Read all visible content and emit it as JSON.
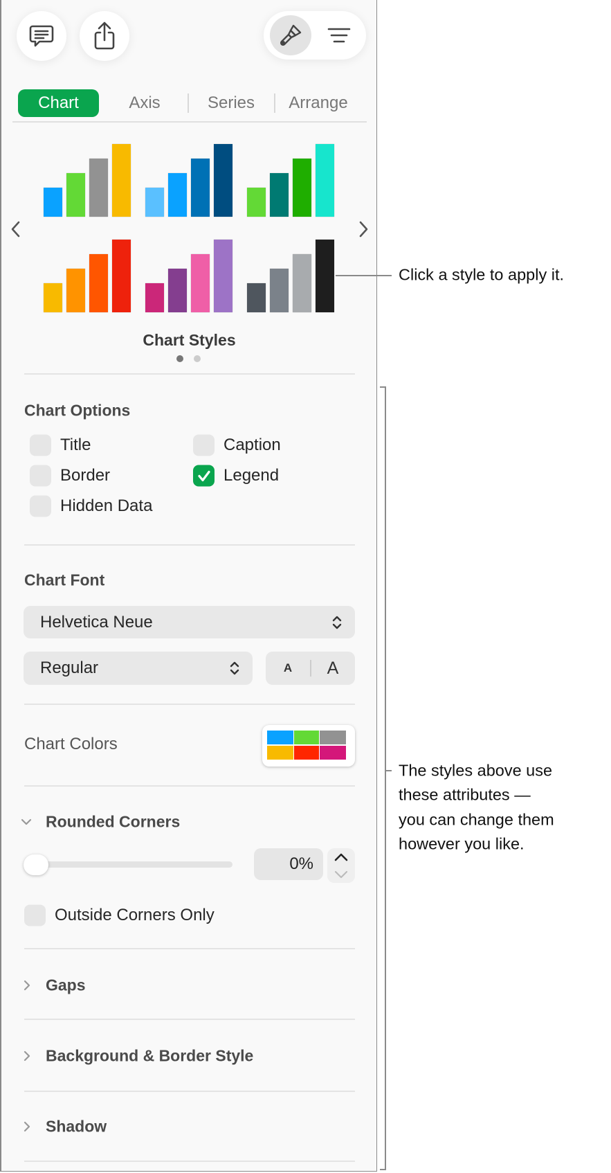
{
  "toolbar": {
    "comment_icon": "comment-bubble-icon",
    "share_icon": "share-icon",
    "format_icon": "paintbrush-icon",
    "organize_icon": "filter-lines-icon"
  },
  "tabs": [
    {
      "label": "Chart",
      "active": true
    },
    {
      "label": "Axis",
      "active": false
    },
    {
      "label": "Series",
      "active": false
    },
    {
      "label": "Arrange",
      "active": false
    }
  ],
  "chart_styles": {
    "label": "Chart Styles",
    "page": 1,
    "page_count": 2,
    "styles": [
      [
        "#0aa2ff",
        "#63d936",
        "#929292",
        "#f8ba00"
      ],
      [
        "#5ac0ff",
        "#0aa2ff",
        "#0071b5",
        "#004d80"
      ],
      [
        "#63d936",
        "#007a72",
        "#1fae00",
        "#17e5cd"
      ],
      [
        "#f8ba00",
        "#ff9300",
        "#ff5600",
        "#ee220c"
      ],
      [
        "#cb2779",
        "#843e8f",
        "#ef5fa7",
        "#9d73c6"
      ],
      [
        "#4f565e",
        "#7b828a",
        "#a8abae",
        "#1e1e1e"
      ]
    ]
  },
  "chart_options": {
    "heading": "Chart Options",
    "items": [
      {
        "label": "Title",
        "checked": false
      },
      {
        "label": "Caption",
        "checked": false
      },
      {
        "label": "Border",
        "checked": false
      },
      {
        "label": "Legend",
        "checked": true
      },
      {
        "label": "Hidden Data",
        "checked": false
      }
    ]
  },
  "chart_font": {
    "heading": "Chart Font",
    "family": "Helvetica Neue",
    "style": "Regular",
    "smaller_label": "A",
    "larger_label": "A"
  },
  "chart_colors": {
    "label": "Chart Colors",
    "swatches": [
      "#0aa2ff",
      "#63d936",
      "#929292",
      "#f8ba00",
      "#ff2600",
      "#d4177a"
    ]
  },
  "rounded_corners": {
    "heading": "Rounded Corners",
    "value": "0%",
    "slider_percent": 0,
    "outside_only_label": "Outside Corners Only",
    "outside_only_checked": false
  },
  "collapsed_sections": [
    "Gaps",
    "Background & Border Style",
    "Shadow"
  ],
  "callouts": {
    "styles": "Click a style to apply it.",
    "attributes": [
      "The styles above use",
      "these attributes —",
      "you can change them",
      "however you like."
    ]
  },
  "colors": {
    "accent": "#0aa54e"
  }
}
